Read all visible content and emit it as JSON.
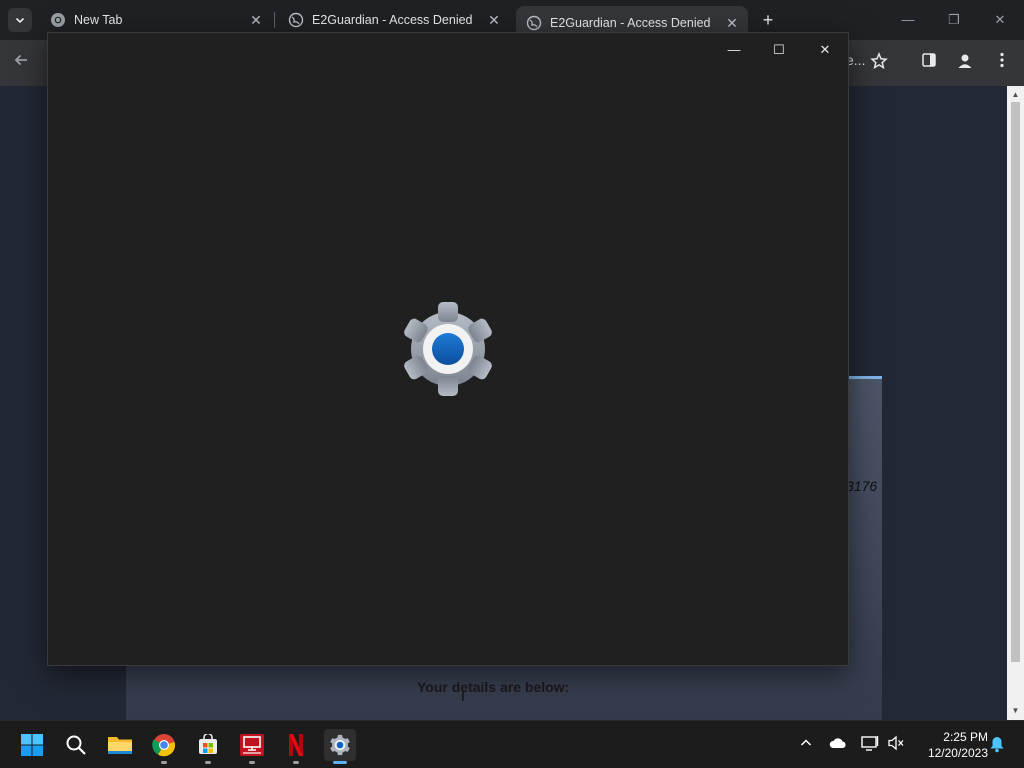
{
  "browser": {
    "tabs": [
      {
        "title": "New Tab",
        "icon": "chrome-icon"
      },
      {
        "title": "E2Guardian - Access Denied",
        "icon": "globe-icon"
      },
      {
        "title": "E2Guardian - Access Denied",
        "icon": "globe-icon",
        "active": true
      }
    ],
    "new_tab_label": "+",
    "address_tail": "e...",
    "page": {
      "partial_number": "3176",
      "details_heading": "Your details are below:"
    }
  },
  "settings_window": {
    "minimize_label": "—",
    "maximize_label": "☐",
    "close_label": "✕",
    "splash_icon": "settings-gear-icon"
  },
  "taskbar": {
    "apps": [
      "windows-start-icon",
      "search-icon",
      "file-explorer-icon",
      "chrome-icon",
      "microsoft-store-icon",
      "remote-desktop-icon",
      "netflix-icon",
      "settings-icon"
    ],
    "time": "2:25 PM",
    "date": "12/20/2023"
  },
  "colors": {
    "accent": "#0a64c0",
    "taskbar_indicator": "#5fb2f2",
    "card_border": "#7fb4e6"
  }
}
